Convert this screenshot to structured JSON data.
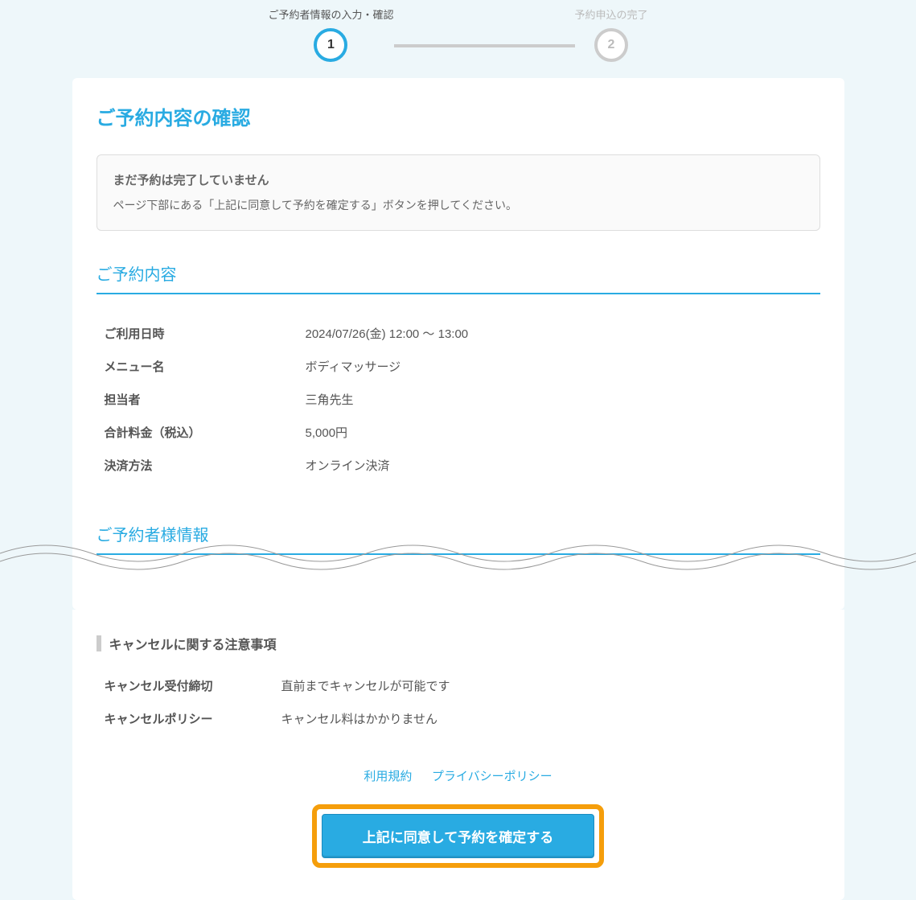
{
  "stepper": {
    "step1": {
      "label": "ご予約者情報の入力・確認",
      "number": "1"
    },
    "step2": {
      "label": "予約申込の完了",
      "number": "2"
    }
  },
  "pageTitle": "ご予約内容の確認",
  "notice": {
    "title": "まだ予約は完了していません",
    "text": "ページ下部にある「上記に同意して予約を確定する」ボタンを押してください。"
  },
  "reservation": {
    "sectionTitle": "ご予約内容",
    "rows": [
      {
        "label": "ご利用日時",
        "value": "2024/07/26(金) 12:00 〜 13:00"
      },
      {
        "label": "メニュー名",
        "value": "ボディマッサージ"
      },
      {
        "label": "担当者",
        "value": "三角先生"
      },
      {
        "label": "合計料金（税込）",
        "value": "5,000円"
      },
      {
        "label": "決済方法",
        "value": "オンライン決済"
      }
    ]
  },
  "customerInfo": {
    "sectionTitle": "ご予約者様情報"
  },
  "cancellation": {
    "sectionTitle": "キャンセルに関する注意事項",
    "rows": [
      {
        "label": "キャンセル受付締切",
        "value": "直前までキャンセルが可能です"
      },
      {
        "label": "キャンセルポリシー",
        "value": "キャンセル料はかかりません"
      }
    ]
  },
  "links": {
    "terms": "利用規約",
    "privacy": "プライバシーポリシー"
  },
  "confirmButton": "上記に同意して予約を確定する"
}
